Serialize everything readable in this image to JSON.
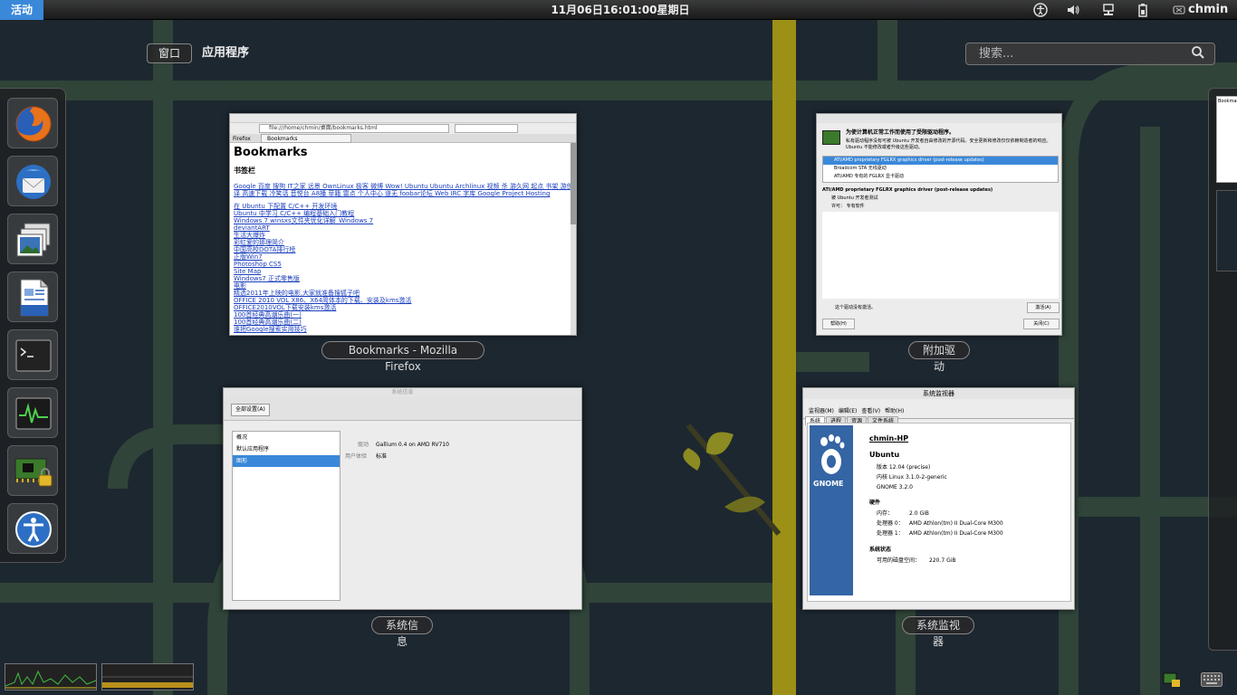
{
  "topbar": {
    "activities": "活动",
    "clock": "11月06日16:01:00星期日",
    "username": "chmin",
    "icons": [
      "accessibility-icon",
      "volume-icon",
      "network-icon",
      "battery-icon",
      "user-icon"
    ]
  },
  "overview": {
    "windows_label": "窗口",
    "apps_label": "应用程序",
    "search_placeholder": "搜索..."
  },
  "dash": {
    "items": [
      "firefox-icon",
      "thunderbird-icon",
      "image-viewer-icon",
      "writer-icon",
      "terminal-icon",
      "system-monitor-icon",
      "additional-drivers-icon",
      "accessibility-icon"
    ]
  },
  "windows": {
    "firefox": {
      "caption": "Bookmarks - Mozilla Firefox",
      "url": "file:///home/chmin/桌面/bookmarks.html",
      "tab": "Bookmarks",
      "menu": "Firefox",
      "title": "Bookmarks",
      "section": "书签栏",
      "links_row1": "Google 百度 搜狗 IT之家 远景 OwnLinux 极客 微博 Wow! Ubuntu Ubuntu Archlinux 视频 杀 游久网 起点 书架 游侠 翻",
      "links_row2": "译 高速下载 冷笑话 音悦台 A8播 菲籍 雷点 个人中心 道无 foobar论坛 Web IRC 字库 Google Project Hosting",
      "links": [
        "在 Ubuntu 下配置 C/C++ 开发环境",
        "Ubuntu 中学习 C/C++ 编程基础入门教程",
        "Windows 7 winsxs文件夹优化详解_Windows 7",
        "deviantART",
        "生活大爆炸",
        "彩虹爱的那理简介",
        "中国高校DOTA排行榜",
        "正版Win7",
        "Photoshop CS5",
        "Site Map",
        "Windows7 正式零售版",
        "电影",
        "精选2011年上映的电影,大家就准备搜狐子吧",
        "OFFICE 2010 VOL X86、X64简体本的下载、安装及kms激活",
        "OFFICE2010VOL下载安装kms激活",
        "100首经典高潮乐曲(一)",
        "100首经典高潮乐曲(二)",
        "谁把Google搜索实用技巧"
      ]
    },
    "drivers": {
      "caption": "附加驱动",
      "header": "为使计算机正常工作而使用了受限驱动程序。",
      "desc": "私有驱动程序没有可被 Ubuntu 开发者自由修改的开源代码。安全更新和修改仅仅依赖制造者的响应。Ubuntu 不能修改或者升级这些驱动。",
      "list": [
        "ATI/AMD proprietary FGLRX graphics driver (post-release updates)",
        "Broadcom STA 无线驱动",
        "ATI/AMD 专有的 FGLRX 显卡驱动"
      ],
      "detail_title": "ATI/AMD proprietary FGLRX graphics driver (post-release updates)",
      "detail_1": "被 Ubuntu 开发者测试",
      "detail_2": "许可：  专有软件",
      "status": "这个驱动没有激活。",
      "activate": "激活(A)",
      "help": "帮助(H)",
      "close": "关闭(C)"
    },
    "sysinfo": {
      "caption": "系统信息",
      "titlebar": "系统信息",
      "all_settings": "全部设置(A)",
      "sidebar": [
        "概况",
        "默认应用程序",
        "图形"
      ],
      "driver_label": "驱动",
      "driver_value": "Gallium 0.4 on AMD RV710",
      "experience_label": "用户体验",
      "experience_value": "标准"
    },
    "sysmon": {
      "caption": "系统监视器",
      "titlebar": "系统监视器",
      "menu": [
        "监视器(M)",
        "编辑(E)",
        "查看(V)",
        "帮助(H)"
      ],
      "tabs": [
        "系统",
        "进程",
        "资源",
        "文件系统"
      ],
      "hostname": "chmin-HP",
      "distro": "Ubuntu",
      "version": "版本 12.04 (precise)",
      "kernel": "内核 Linux 3.1.0-2-generic",
      "gnome": "GNOME 3.2.0",
      "hw_title": "硬件",
      "mem_label": "内存：",
      "mem_value": "2.0 GiB",
      "cpu0_label": "处理器 0：",
      "cpu0_value": "AMD Athlon(tm) II Dual-Core M300",
      "cpu1_label": "处理器 1：",
      "cpu1_value": "AMD Athlon(tm) II Dual-Core M300",
      "status_title": "系统状态",
      "disk_label": "可用的磁盘空间：",
      "disk_value": "220.7 GiB",
      "logo_text": "GNOME"
    }
  },
  "colors": {
    "accent": "#3a88d9",
    "bg_dark": "#1d2730",
    "bg_green": "#2a3a2a",
    "line_green": "#3f5a3a",
    "line_yellow": "#a89a1a"
  }
}
